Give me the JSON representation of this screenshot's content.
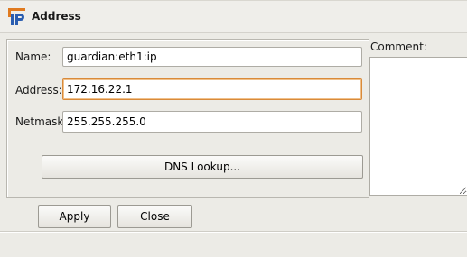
{
  "window": {
    "title": "Address"
  },
  "icons": {
    "app": "ip-address-icon"
  },
  "form": {
    "name_label": "Name:",
    "name_value": "guardian:eth1:ip",
    "address_label": "Address:",
    "address_value": "172.16.22.1",
    "netmask_label": "Netmask:",
    "netmask_value": "255.255.255.0",
    "dns_lookup_label": "DNS Lookup..."
  },
  "comment": {
    "label": "Comment:",
    "value": ""
  },
  "actions": {
    "apply_label": "Apply",
    "close_label": "Close"
  },
  "colors": {
    "focus_border": "#d98a3a",
    "icon_blue": "#2a5db0",
    "icon_orange": "#e07a1f"
  }
}
